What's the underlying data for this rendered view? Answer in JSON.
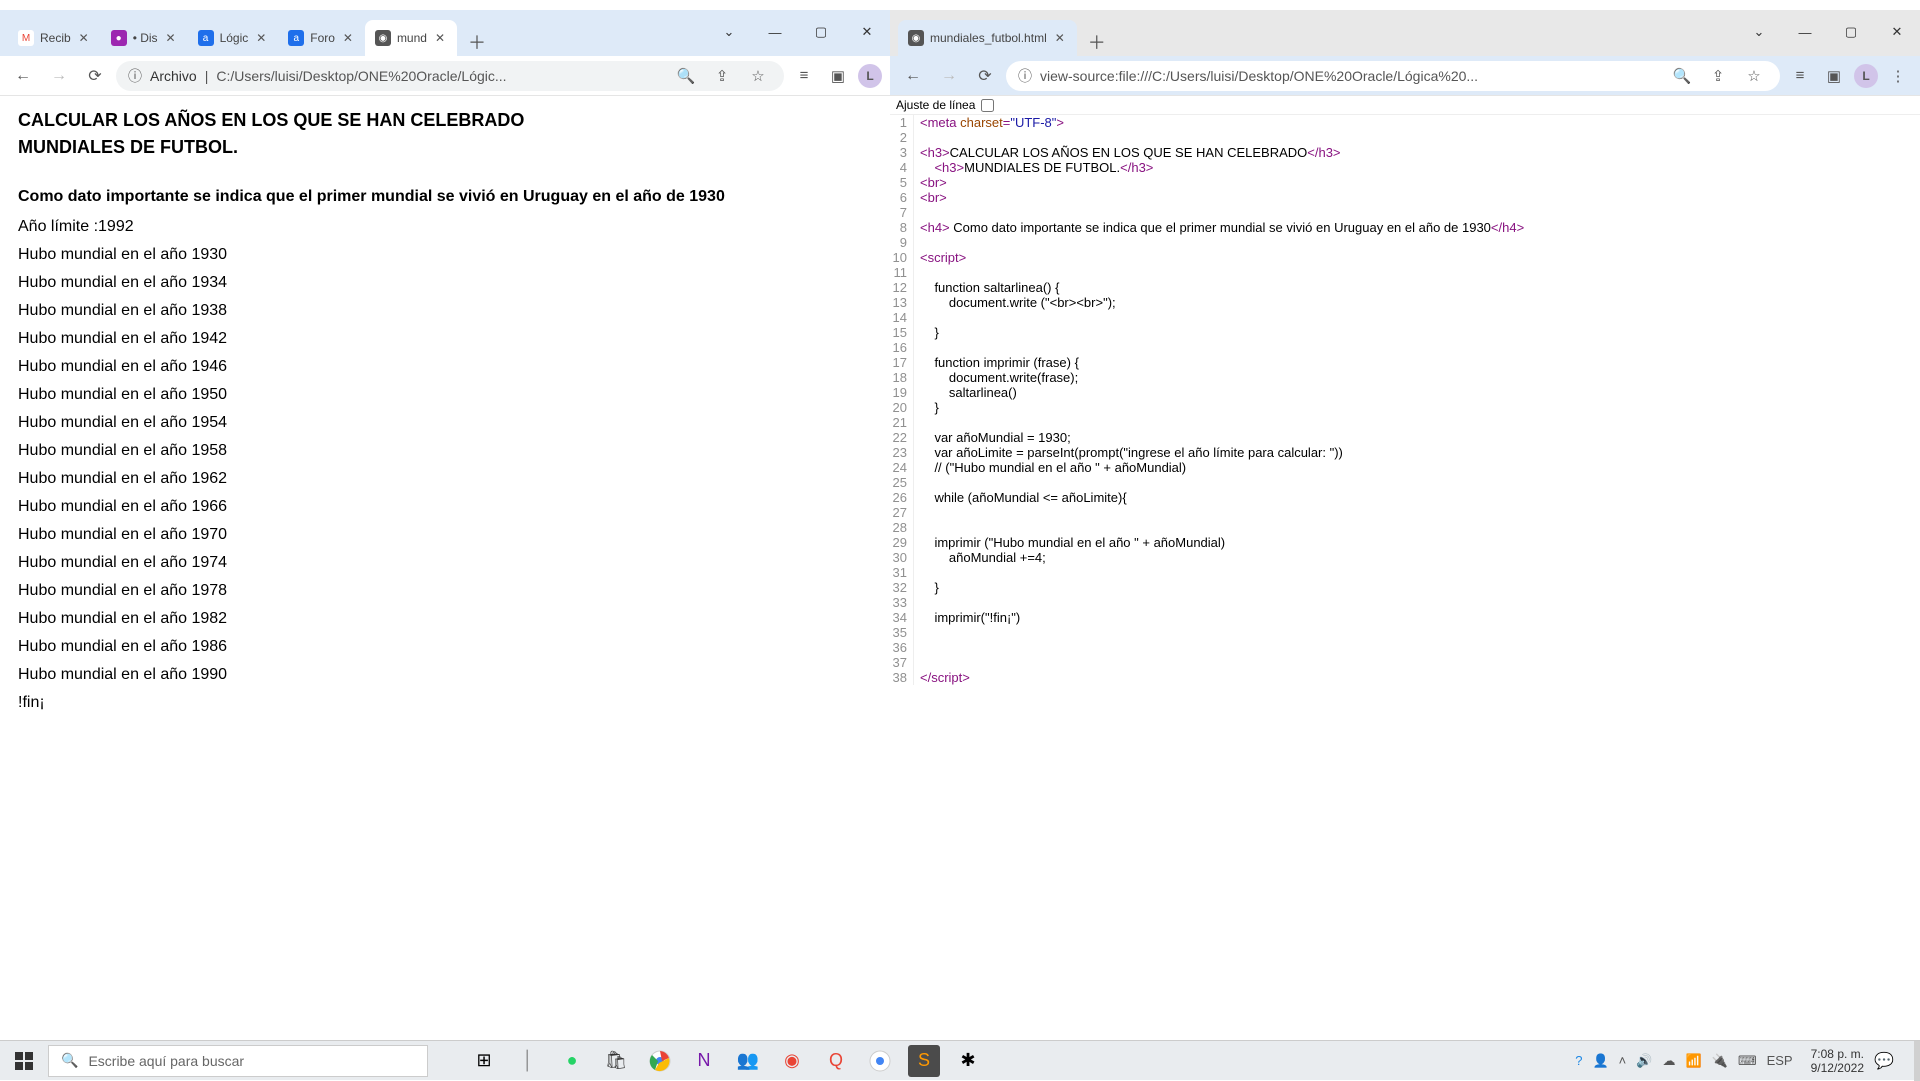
{
  "left_window": {
    "tabs": [
      {
        "fav_bg": "#fff",
        "fav_fg": "#ea4335",
        "fav": "M",
        "label": "Recib",
        "active": false
      },
      {
        "fav_bg": "#9c27b0",
        "fav_fg": "#fff",
        "fav": "●",
        "label": "• Dis",
        "active": false
      },
      {
        "fav_bg": "#1f6feb",
        "fav_fg": "#fff",
        "fav": "a",
        "label": "Lógic",
        "active": false
      },
      {
        "fav_bg": "#1f6feb",
        "fav_fg": "#fff",
        "fav": "a",
        "label": "Foro",
        "active": false
      },
      {
        "fav_bg": "#555",
        "fav_fg": "#fff",
        "fav": "◉",
        "label": "mund",
        "active": true
      }
    ],
    "url_prefix": "Archivo",
    "url": "C:/Users/luisi/Desktop/ONE%20Oracle/Lógic...",
    "page": {
      "h3a": "CALCULAR LOS AÑOS EN LOS QUE SE HAN CELEBRADO",
      "h3b": "MUNDIALES DE FUTBOL.",
      "h4": "Como dato importante se indica que el primer mundial se vivió en Uruguay en el año de 1930",
      "limite": "Año límite :1992",
      "rows": [
        "Hubo mundial en el año 1930",
        "Hubo mundial en el año 1934",
        "Hubo mundial en el año 1938",
        "Hubo mundial en el año 1942",
        "Hubo mundial en el año 1946",
        "Hubo mundial en el año 1950",
        "Hubo mundial en el año 1954",
        "Hubo mundial en el año 1958",
        "Hubo mundial en el año 1962",
        "Hubo mundial en el año 1966",
        "Hubo mundial en el año 1970",
        "Hubo mundial en el año 1974",
        "Hubo mundial en el año 1978",
        "Hubo mundial en el año 1982",
        "Hubo mundial en el año 1986",
        "Hubo mundial en el año 1990"
      ],
      "fin": "!fin¡"
    }
  },
  "right_window": {
    "tab_label": "mundiales_futbol.html",
    "url": "view-source:file:///C:/Users/luisi/Desktop/ONE%20Oracle/Lógica%20...",
    "line_wrap_label": "Ajuste de línea",
    "source": [
      {
        "n": 1,
        "seg": [
          [
            "tag",
            "<meta "
          ],
          [
            "attrn",
            "charset"
          ],
          [
            "tag",
            "="
          ],
          [
            "attrv",
            "\"UTF-8\""
          ],
          [
            "tag",
            ">"
          ]
        ]
      },
      {
        "n": 2,
        "seg": [
          [
            "txt",
            ""
          ]
        ]
      },
      {
        "n": 3,
        "seg": [
          [
            "tag",
            "<h3>"
          ],
          [
            "txt",
            "CALCULAR LOS AÑOS EN LOS QUE SE HAN CELEBRADO"
          ],
          [
            "tag",
            "</h3>"
          ]
        ]
      },
      {
        "n": 4,
        "seg": [
          [
            "txt",
            "    "
          ],
          [
            "tag",
            "<h3>"
          ],
          [
            "txt",
            "MUNDIALES DE FUTBOL."
          ],
          [
            "tag",
            "</h3>"
          ]
        ]
      },
      {
        "n": 5,
        "seg": [
          [
            "tag",
            "<br>"
          ]
        ]
      },
      {
        "n": 6,
        "seg": [
          [
            "tag",
            "<br>"
          ]
        ]
      },
      {
        "n": 7,
        "seg": [
          [
            "txt",
            ""
          ]
        ]
      },
      {
        "n": 8,
        "seg": [
          [
            "tag",
            "<h4>"
          ],
          [
            "txt",
            " Como dato importante se indica que el primer mundial se vivió en Uruguay en el año de 1930"
          ],
          [
            "tag",
            "</h4>"
          ]
        ]
      },
      {
        "n": 9,
        "seg": [
          [
            "txt",
            ""
          ]
        ]
      },
      {
        "n": 10,
        "seg": [
          [
            "tag",
            "<script>"
          ]
        ]
      },
      {
        "n": 11,
        "seg": [
          [
            "txt",
            ""
          ]
        ]
      },
      {
        "n": 12,
        "seg": [
          [
            "txt",
            "    function saltarlinea() {"
          ]
        ]
      },
      {
        "n": 13,
        "seg": [
          [
            "txt",
            "        document.write (\"<br><br>\");"
          ]
        ]
      },
      {
        "n": 14,
        "seg": [
          [
            "txt",
            ""
          ]
        ]
      },
      {
        "n": 15,
        "seg": [
          [
            "txt",
            "    }"
          ]
        ]
      },
      {
        "n": 16,
        "seg": [
          [
            "txt",
            ""
          ]
        ]
      },
      {
        "n": 17,
        "seg": [
          [
            "txt",
            "    function imprimir (frase) {"
          ]
        ]
      },
      {
        "n": 18,
        "seg": [
          [
            "txt",
            "        document.write(frase);"
          ]
        ]
      },
      {
        "n": 19,
        "seg": [
          [
            "txt",
            "        saltarlinea()"
          ]
        ]
      },
      {
        "n": 20,
        "seg": [
          [
            "txt",
            "    }"
          ]
        ]
      },
      {
        "n": 21,
        "seg": [
          [
            "txt",
            ""
          ]
        ]
      },
      {
        "n": 22,
        "seg": [
          [
            "txt",
            "    var añoMundial = 1930;"
          ]
        ]
      },
      {
        "n": 23,
        "seg": [
          [
            "txt",
            "    var añoLimite = parseInt(prompt(\"ingrese el año límite para calcular: \"))"
          ]
        ]
      },
      {
        "n": 24,
        "seg": [
          [
            "txt",
            "    // (\"Hubo mundial en el año \" + añoMundial)"
          ]
        ]
      },
      {
        "n": 25,
        "seg": [
          [
            "txt",
            ""
          ]
        ]
      },
      {
        "n": 26,
        "seg": [
          [
            "txt",
            "    while (añoMundial <= añoLimite){"
          ]
        ]
      },
      {
        "n": 27,
        "seg": [
          [
            "txt",
            ""
          ]
        ]
      },
      {
        "n": 28,
        "seg": [
          [
            "txt",
            ""
          ]
        ]
      },
      {
        "n": 29,
        "seg": [
          [
            "txt",
            "    imprimir (\"Hubo mundial en el año \" + añoMundial)"
          ]
        ]
      },
      {
        "n": 30,
        "seg": [
          [
            "txt",
            "        añoMundial +=4;"
          ]
        ]
      },
      {
        "n": 31,
        "seg": [
          [
            "txt",
            ""
          ]
        ]
      },
      {
        "n": 32,
        "seg": [
          [
            "txt",
            "    }"
          ]
        ]
      },
      {
        "n": 33,
        "seg": [
          [
            "txt",
            ""
          ]
        ]
      },
      {
        "n": 34,
        "seg": [
          [
            "txt",
            "    imprimir(\"!fin¡\")"
          ]
        ]
      },
      {
        "n": 35,
        "seg": [
          [
            "txt",
            ""
          ]
        ]
      },
      {
        "n": 36,
        "seg": [
          [
            "txt",
            ""
          ]
        ]
      },
      {
        "n": 37,
        "seg": [
          [
            "txt",
            ""
          ]
        ]
      },
      {
        "n": 38,
        "seg": [
          [
            "tag",
            "</script>"
          ]
        ]
      }
    ]
  },
  "taskbar": {
    "search_placeholder": "Escribe aquí para buscar",
    "lang": "ESP",
    "time": "7:08 p. m.",
    "date": "9/12/2022"
  }
}
